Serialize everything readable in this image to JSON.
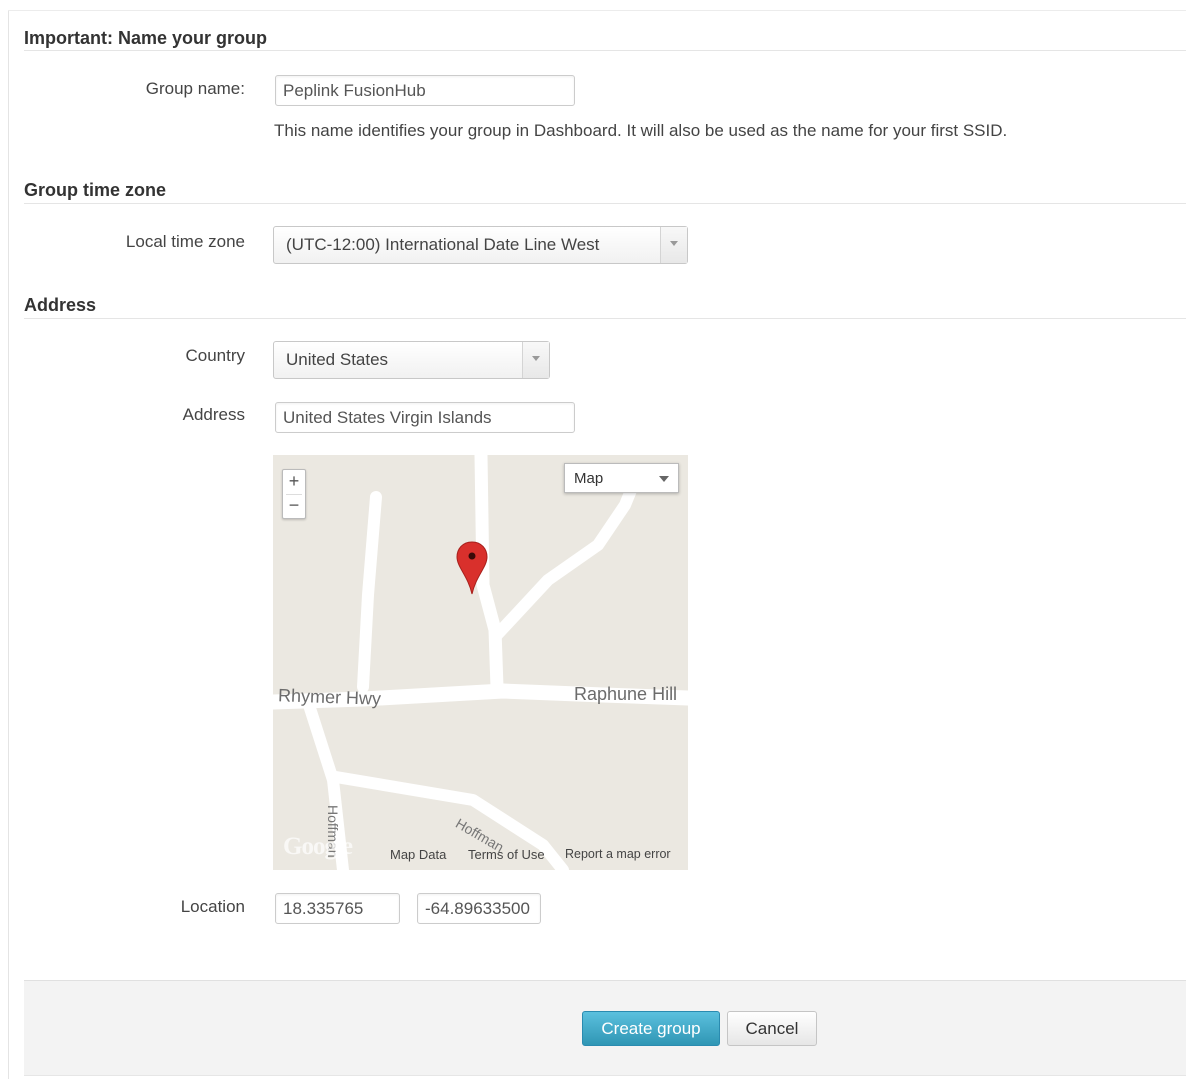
{
  "section_name": {
    "heading": "Important: Name your group",
    "group_name_label": "Group name:",
    "group_name_value": "Peplink FusionHub",
    "help_text": "This name identifies your group in Dashboard. It will also be used as the name for your first SSID."
  },
  "section_timezone": {
    "heading": "Group time zone",
    "timezone_label": "Local time zone",
    "timezone_value": "(UTC-12:00) International Date Line West"
  },
  "section_address": {
    "heading": "Address",
    "country_label": "Country",
    "country_value": "United States",
    "address_label": "Address",
    "address_value": "United States Virgin Islands",
    "location_label": "Location",
    "latitude_value": "18.335765",
    "longitude_value": "-64.89633500"
  },
  "map": {
    "zoom_in": "+",
    "zoom_out": "−",
    "map_type": "Map",
    "roads": [
      "Rhymer Hwy",
      "Raphune Hill",
      "Hoffman",
      "Hoffman"
    ],
    "logo": "Google",
    "footer_links": [
      "Map Data",
      "Terms of Use",
      "Report a map error"
    ],
    "pin_color": "#d9302c"
  },
  "actions": {
    "create_label": "Create group",
    "cancel_label": "Cancel",
    "primary_color": "#2f96b4"
  }
}
